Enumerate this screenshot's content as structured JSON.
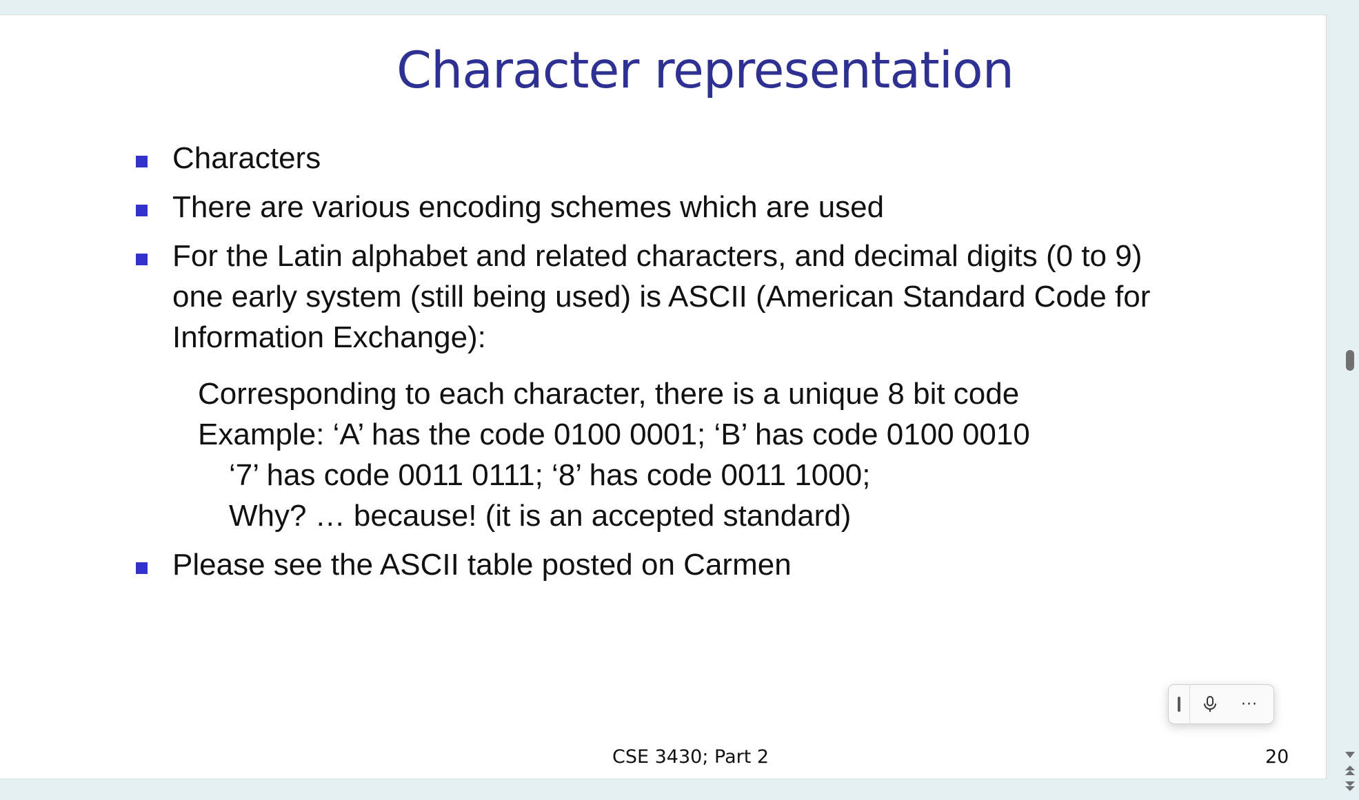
{
  "slide": {
    "title": "Character representation",
    "bullets": [
      {
        "text": "Characters"
      },
      {
        "text": "There are various encoding schemes which are used"
      },
      {
        "lines": [
          "For the Latin alphabet and related characters, and decimal digits (0 to 9)",
          "one early system (still being used) is ASCII (American Standard Code for",
          "Information Exchange):"
        ]
      },
      {
        "text": "Please see the ASCII table posted on Carmen"
      }
    ],
    "sub_lines": [
      "Corresponding to each character, there is a unique 8 bit code",
      "Example: ‘A’ has the code 0100 0001; ‘B’ has code 0100 0010",
      "‘7’ has code 0011 0111; ‘8’ has code 0011 1000;",
      "Why? … because! (it is an accepted standard)"
    ],
    "footer": {
      "course": "CSE 3430; Part 2",
      "page_number": "20"
    },
    "bullet_color": "#3333cc",
    "title_color": "#2e3192"
  },
  "toolbar": {
    "grip_icon": "grip-handle-icon",
    "mic_icon": "microphone-icon",
    "more_label": "···"
  },
  "scrollbar": {
    "icons": [
      "scroll-down-arrow-icon",
      "page-up-icon",
      "page-down-icon"
    ]
  }
}
